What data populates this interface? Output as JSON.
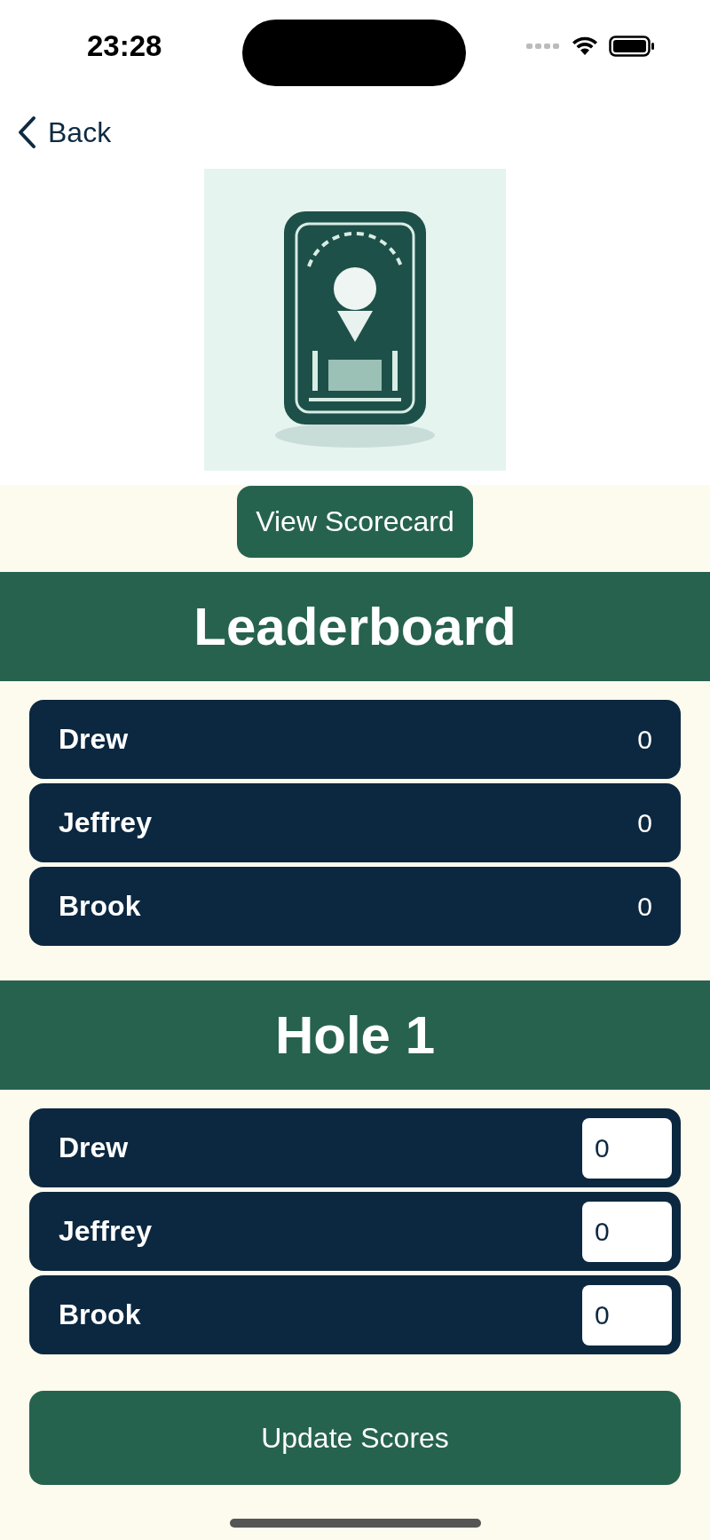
{
  "status_bar": {
    "time": "23:28"
  },
  "nav": {
    "back_label": "Back"
  },
  "scorecard_button": "View Scorecard",
  "leaderboard": {
    "title": "Leaderboard",
    "rows": [
      {
        "name": "Drew",
        "score": "0"
      },
      {
        "name": "Jeffrey",
        "score": "0"
      },
      {
        "name": "Brook",
        "score": "0"
      }
    ]
  },
  "hole": {
    "title": "Hole 1",
    "rows": [
      {
        "name": "Drew",
        "value": "0"
      },
      {
        "name": "Jeffrey",
        "value": "0"
      },
      {
        "name": "Brook",
        "value": "0"
      }
    ]
  },
  "update_button": "Update Scores"
}
